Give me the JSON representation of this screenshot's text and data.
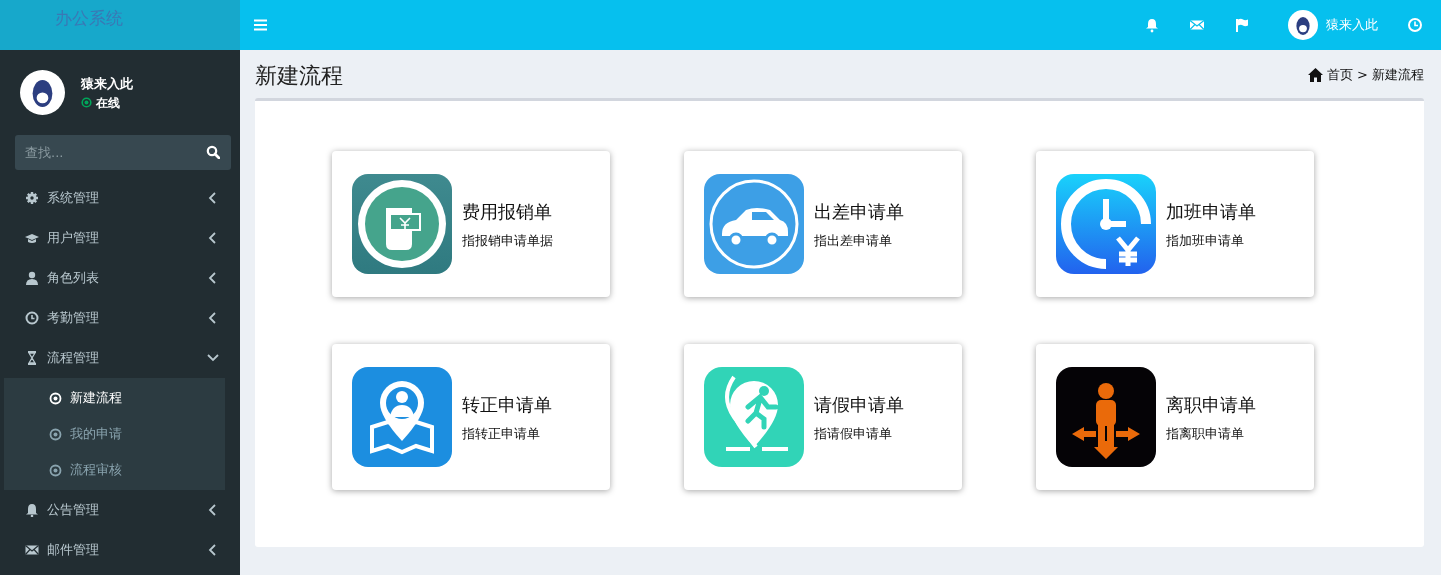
{
  "brand": "办公系统",
  "user": {
    "name": "猿来入此",
    "status": "在线"
  },
  "search": {
    "placeholder": "查找..."
  },
  "menu": [
    {
      "label": "系统管理",
      "expanded": false
    },
    {
      "label": "用户管理",
      "expanded": false
    },
    {
      "label": "角色列表",
      "expanded": false
    },
    {
      "label": "考勤管理",
      "expanded": false
    },
    {
      "label": "流程管理",
      "expanded": true,
      "children": [
        {
          "label": "新建流程",
          "selected": true
        },
        {
          "label": "我的申请",
          "selected": false
        },
        {
          "label": "流程审核",
          "selected": false
        }
      ]
    },
    {
      "label": "公告管理",
      "expanded": false
    },
    {
      "label": "邮件管理",
      "expanded": false
    }
  ],
  "header": {
    "user_name": "猿来入此"
  },
  "page": {
    "title": "新建流程",
    "breadcrumb": [
      {
        "label": "首页"
      },
      {
        "label": "新建流程"
      }
    ],
    "separator": ">"
  },
  "cards": [
    {
      "title": "费用报销单",
      "subtitle": "指报销申请单据"
    },
    {
      "title": "出差申请单",
      "subtitle": "指出差申请单"
    },
    {
      "title": "加班申请单",
      "subtitle": "指加班申请单"
    },
    {
      "title": "转正申请单",
      "subtitle": "指转正申请单"
    },
    {
      "title": "请假申请单",
      "subtitle": "指请假申请单"
    },
    {
      "title": "离职申请单",
      "subtitle": "指离职申请单"
    }
  ]
}
